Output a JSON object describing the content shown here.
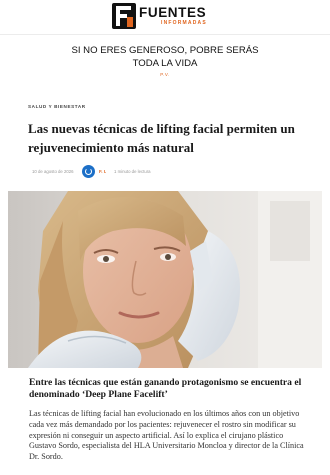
{
  "header": {
    "brand_name": "FUENTES",
    "brand_sub": "INFORMADAS",
    "logo_letter": "F"
  },
  "promo": {
    "line1": "SI NO ERES GENEROSO, POBRE SERÁS",
    "line2": "TODA LA VIDA",
    "tag": "P.V."
  },
  "article": {
    "category": "SALUD Y BIENESTAR",
    "title": "Las nuevas técnicas de lifting facial permiten un rejuvenecimiento más natural",
    "date": "10 de agosto de 2026",
    "author": "F. I.",
    "reading_time": "1 minuto de lectura",
    "caption": "Entre las técnicas que están ganando protagonismo se encuentra el denominado ‘Deep Plane Facelift’",
    "body": "Las técnicas de lifting facial han evolucionado en los últimos años con un objetivo cada vez más demandado por los pacientes: rejuvenecer el rostro sin modificar su expresión ni conseguir un aspecto artificial. Así lo explica el cirujano plástico Gustavo Sordo, especialista del HLA Universitario Moncloa y director de la Clínica Dr. Sordo."
  },
  "colors": {
    "accent": "#e0651f",
    "avatar": "#1c6fc7"
  }
}
